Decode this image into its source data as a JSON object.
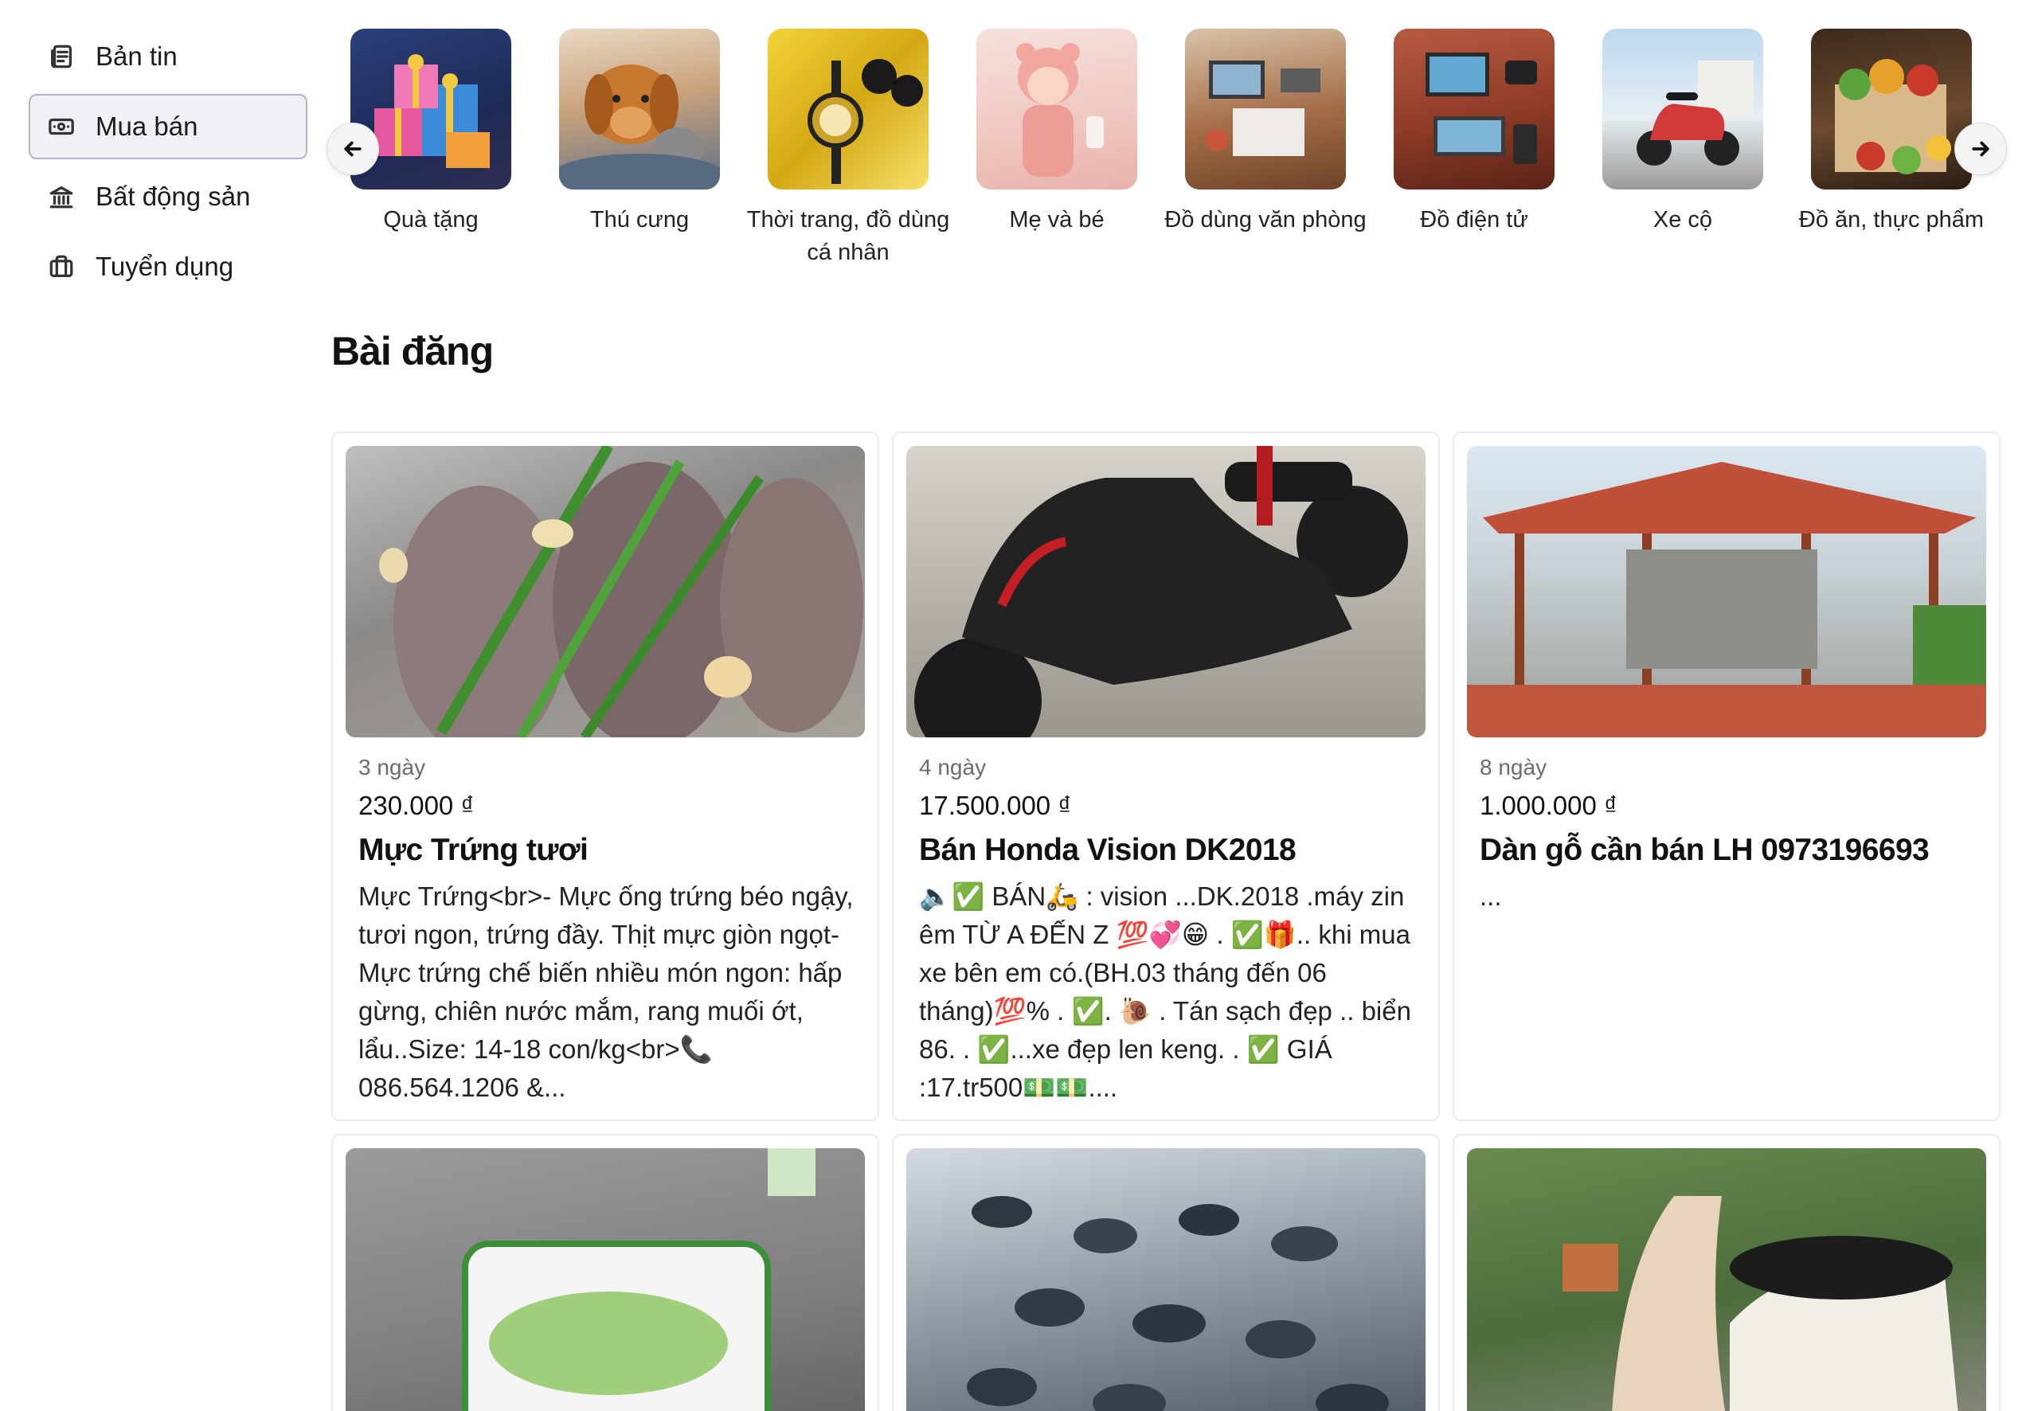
{
  "sidebar": {
    "items": [
      {
        "label": "Bản tin",
        "icon": "newspaper-icon"
      },
      {
        "label": "Mua bán",
        "icon": "banknote-icon",
        "active": true
      },
      {
        "label": "Bất động sản",
        "icon": "bank-icon"
      },
      {
        "label": "Tuyển dụng",
        "icon": "briefcase-icon"
      }
    ]
  },
  "categories": {
    "items": [
      {
        "label": "Quà tặng"
      },
      {
        "label": "Thú cưng"
      },
      {
        "label": "Thời trang, đồ dùng cá nhân"
      },
      {
        "label": "Mẹ và bé"
      },
      {
        "label": "Đồ dùng văn phòng"
      },
      {
        "label": "Đồ điện tử"
      },
      {
        "label": "Xe cộ"
      },
      {
        "label": "Đồ ăn, thực phẩm"
      }
    ],
    "prev_icon": "arrow-left-icon",
    "next_icon": "arrow-right-icon"
  },
  "posts": {
    "title": "Bài đăng",
    "items": [
      {
        "age": "3 ngày",
        "price": "230.000 ₫",
        "title": "Mực Trứng tươi",
        "desc": "Mực Trứng<br>- Mực ống trứng béo ngậy, tươi ngon, trứng đầy. Thịt mực giòn ngọt- Mực trứng chế biến nhiều món ngon: hấp gừng, chiên nước mắm, rang muối ớt, lẩu..Size: 14-18 con/kg<br>📞 086.564.1206 &..."
      },
      {
        "age": "4 ngày",
        "price": "17.500.000 ₫",
        "title": "Bán Honda Vision DK2018",
        "desc": "🔈✅ BÁN🛵 : vision ...DK.2018 .máy zin êm TỪ A ĐẾN Z 💯💞😁 . ✅🎁.. khi mua xe bên em có.(BH.03 tháng đến 06 tháng)💯% . ✅. 🐌 . Tán sạch đẹp .. biển 86. . ✅...xe đẹp len keng. . ✅ GIÁ :17.tr500💵💵...."
      },
      {
        "age": "8 ngày",
        "price": "1.000.000 ₫",
        "title": "Dàn gỗ cần bán LH 0973196693",
        "desc": "..."
      },
      {},
      {},
      {}
    ]
  }
}
